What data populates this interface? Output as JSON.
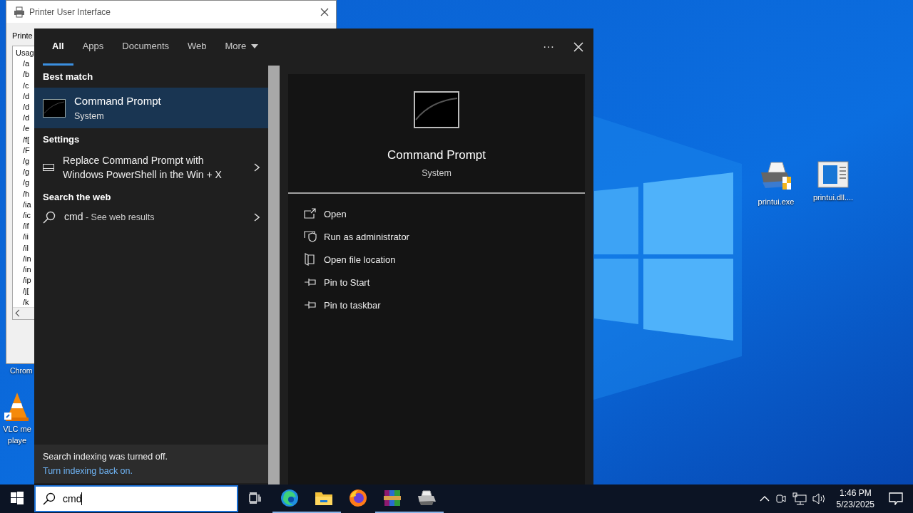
{
  "printer_window": {
    "title": "Printer User Interface",
    "label": "Printe",
    "list_heading": "Usag",
    "list_lines": [
      "/a",
      "/b",
      "/c",
      "/d",
      "/d",
      "/d",
      "/e",
      "/f[",
      "/F",
      "/g",
      "/g",
      "/g",
      "/h",
      "/ia",
      "/ic",
      "/if",
      "/ii",
      "/il",
      "/in",
      "/in",
      "/ip",
      "/j[",
      "/k"
    ]
  },
  "desktop_icons_left": [
    {
      "kind": "vlc",
      "lines": [
        "VLC me",
        "playe"
      ]
    }
  ],
  "desktop_icons_right": [
    {
      "kind": "printer",
      "label": "printui.exe"
    },
    {
      "kind": "dll",
      "label": "printui.dll...."
    }
  ],
  "partial_label": "Chrom",
  "search_panel": {
    "tabs": [
      {
        "label": "All",
        "selected": true,
        "kind": "plain"
      },
      {
        "label": "Apps",
        "selected": false,
        "kind": "plain"
      },
      {
        "label": "Documents",
        "selected": false,
        "kind": "plain"
      },
      {
        "label": "Web",
        "selected": false,
        "kind": "plain"
      },
      {
        "label": "More",
        "selected": false,
        "kind": "dropdown"
      }
    ],
    "more_menu": "···",
    "best_match": {
      "heading": "Best match",
      "title": "Command Prompt",
      "subtitle": "System",
      "selected": true
    },
    "settings": {
      "heading": "Settings",
      "items": [
        {
          "text": "Replace Command Prompt with Windows PowerShell in the Win + X"
        }
      ]
    },
    "web": {
      "heading": "Search the web",
      "query": "cmd",
      "suffix": " - See web results"
    },
    "footer": {
      "notice": "Search indexing was turned off.",
      "link": "Turn indexing back on."
    },
    "preview": {
      "title": "Command Prompt",
      "subtitle": "System",
      "actions": [
        {
          "label": "Open",
          "kind": "open"
        },
        {
          "label": "Run as administrator",
          "kind": "admin"
        },
        {
          "label": "Open file location",
          "kind": "folder"
        },
        {
          "label": "Pin to Start",
          "kind": "pin"
        },
        {
          "label": "Pin to taskbar",
          "kind": "pin"
        }
      ]
    }
  },
  "taskbar": {
    "search_value": "cmd",
    "apps": [
      {
        "kind": "edge",
        "running": true
      },
      {
        "kind": "explorer",
        "running": true
      },
      {
        "kind": "firefox",
        "running": false
      },
      {
        "kind": "winrar",
        "running": true
      },
      {
        "kind": "printer",
        "running": true
      }
    ],
    "time": "1:46 PM",
    "date": "5/23/2025"
  }
}
